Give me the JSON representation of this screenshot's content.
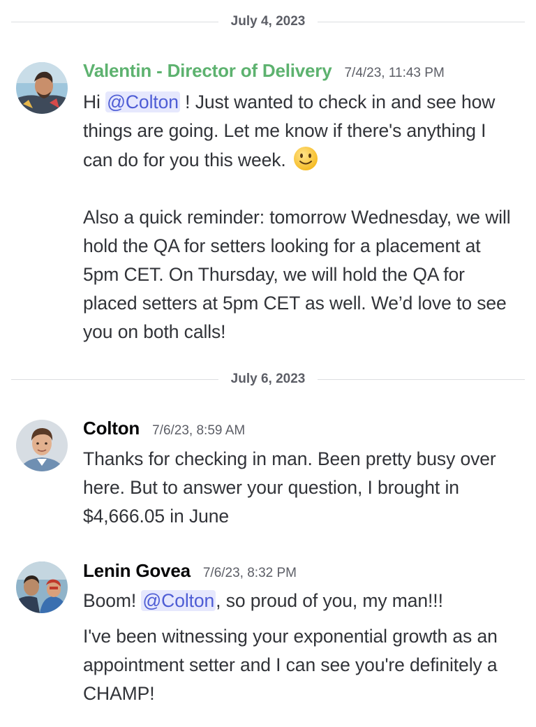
{
  "dividers": [
    {
      "date": "July 4, 2023"
    },
    {
      "date": "July 6, 2023"
    }
  ],
  "messages": [
    {
      "author": "Valentin - Director of Delivery",
      "timestamp": "7/4/23, 11:43 PM",
      "author_color": "#5db26f",
      "p1_before": "Hi ",
      "p1_mention": "@Colton",
      "p1_after": " ! Just wanted to check in and see how things are going. Let me know if there's anything I can do for you this week.",
      "p1_emoji": "slightly-smiling-face",
      "p2": "Also a quick reminder: tomorrow Wednesday, we will hold the QA for setters looking for a placement at 5pm CET. On Thursday, we will hold the QA for placed setters at 5pm CET as well. We’d love to see you on both calls!"
    },
    {
      "author": "Colton",
      "timestamp": "7/6/23, 8:59 AM",
      "text": "Thanks for checking in man. Been pretty busy over here. But to answer your question, I brought in $4,666.05 in June"
    },
    {
      "author": "Lenin Govea",
      "timestamp": "7/6/23, 8:32 PM",
      "p1_before": "Boom! ",
      "p1_mention": "@Colton",
      "p1_after": ", so proud of you, my man!!!",
      "p2": "I've been witnessing your exponential growth as an appointment setter and I can see you're definitely a CHAMP!"
    }
  ],
  "colors": {
    "mention_bg": "#e6e8fd",
    "mention_text": "#4e5dd5",
    "timestamp": "#5c5e66",
    "body_text": "#313338"
  }
}
